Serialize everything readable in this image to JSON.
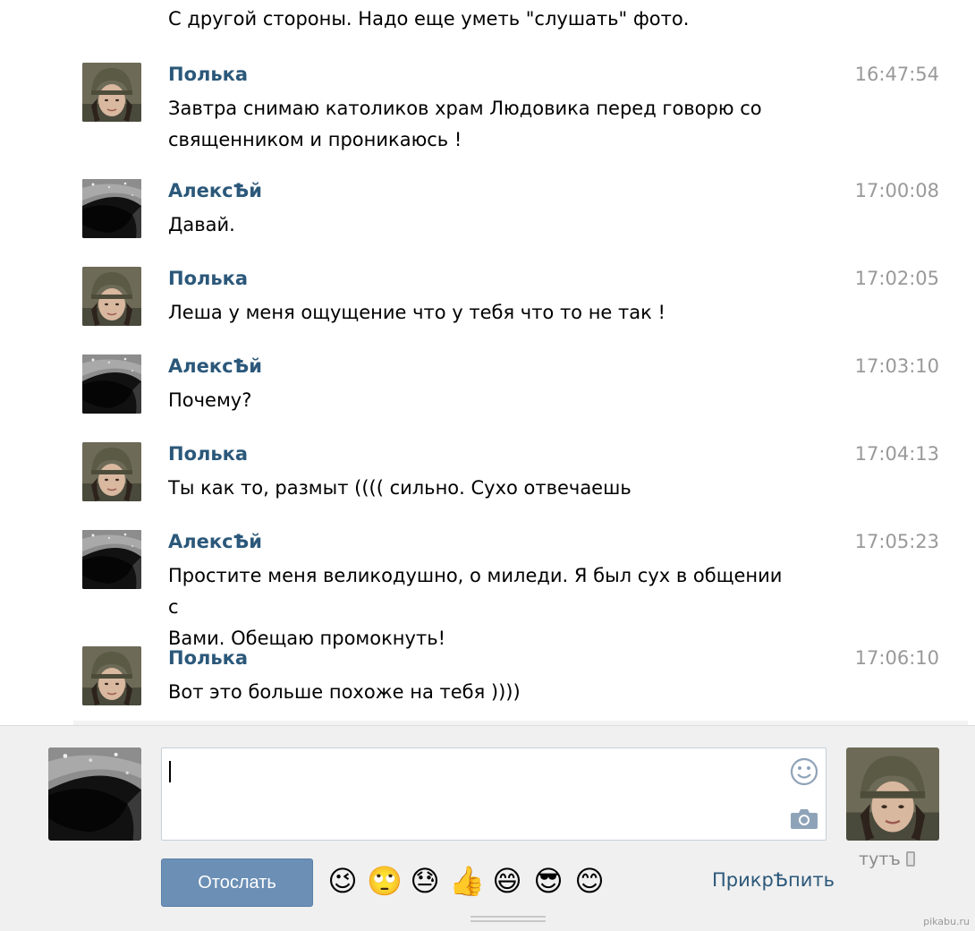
{
  "messages_list": {
    "partial_text": "С другой стороны. Надо еще уметь \"слушать\" фото.",
    "items": [
      {
        "author": "Полька",
        "time": "16:47:54",
        "text_lines": [
          "Завтра снимаю католиков храм Людовика перед говорю со",
          "священником и проникаюсь !"
        ],
        "avatar": "polka"
      },
      {
        "author": "АлексѢй",
        "time": "17:00:08",
        "text_lines": [
          "Давай."
        ],
        "avatar": "alex"
      },
      {
        "author": "Полька",
        "time": "17:02:05",
        "text_lines": [
          "Леша у меня ощущение что у тебя что то не так !"
        ],
        "avatar": "polka"
      },
      {
        "author": "АлексѢй",
        "time": "17:03:10",
        "text_lines": [
          "Почему?"
        ],
        "avatar": "alex"
      },
      {
        "author": "Полька",
        "time": "17:04:13",
        "text_lines": [
          "Ты как то, размыт (((( сильно. Сухо отвечаешь"
        ],
        "avatar": "polka"
      },
      {
        "author": "АлексѢй",
        "time": "17:05:23",
        "text_lines": [
          "Простите меня великодушно, о миледи. Я был сух в общении с",
          "Вами. Обещаю промокнуть!"
        ],
        "avatar": "alex"
      },
      {
        "author": "Полька",
        "time": "17:06:10",
        "text_lines": [
          "Вот это больше похоже на тебя ))))"
        ],
        "avatar": "polka"
      }
    ]
  },
  "compose": {
    "send_label": "Отослать",
    "attach_label": "ПрикрѢпить",
    "peer_status": "тутъ",
    "icons": [
      "smile-icon",
      "camera-icon",
      "mobile-phone-icon"
    ],
    "emojis": [
      {
        "name": "wink-emoji",
        "char": "😉"
      },
      {
        "name": "rolling-eyes-emoji",
        "char": "🙄"
      },
      {
        "name": "sweat-emoji",
        "char": "😓"
      },
      {
        "name": "thumbs-up-emoji",
        "char": "👍"
      },
      {
        "name": "grin-emoji",
        "char": "😄"
      },
      {
        "name": "sunglasses-emoji",
        "char": "😎"
      },
      {
        "name": "blush-emoji",
        "char": "😊"
      }
    ]
  },
  "watermark": "pikabu.ru",
  "colors": {
    "author": "#2b587a",
    "time": "#999999",
    "send_button": "#6b8fb5",
    "compose_bg": "#f0f0f0"
  }
}
